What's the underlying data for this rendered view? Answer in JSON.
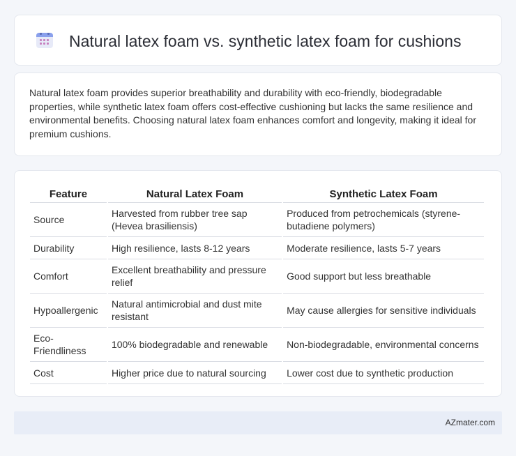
{
  "header": {
    "title": "Natural latex foam vs. synthetic latex foam for cushions",
    "icon": "calendar-icon"
  },
  "summary": {
    "text": "Natural latex foam provides superior breathability and durability with eco-friendly, biodegradable properties, while synthetic latex foam offers cost-effective cushioning but lacks the same resilience and environmental benefits. Choosing natural latex foam enhances comfort and longevity, making it ideal for premium cushions."
  },
  "table": {
    "headers": [
      "Feature",
      "Natural Latex Foam",
      "Synthetic Latex Foam"
    ],
    "rows": [
      [
        "Source",
        "Harvested from rubber tree sap (Hevea brasiliensis)",
        "Produced from petrochemicals (styrene-butadiene polymers)"
      ],
      [
        "Durability",
        "High resilience, lasts 8-12 years",
        "Moderate resilience, lasts 5-7 years"
      ],
      [
        "Comfort",
        "Excellent breathability and pressure relief",
        "Good support but less breathable"
      ],
      [
        "Hypoallergenic",
        "Natural antimicrobial and dust mite resistant",
        "May cause allergies for sensitive individuals"
      ],
      [
        "Eco-Friendliness",
        "100% biodegradable and renewable",
        "Non-biodegradable, environmental concerns"
      ],
      [
        "Cost",
        "Higher price due to natural sourcing",
        "Lower cost due to synthetic production"
      ]
    ]
  },
  "footer": {
    "text": "AZmater.com"
  }
}
